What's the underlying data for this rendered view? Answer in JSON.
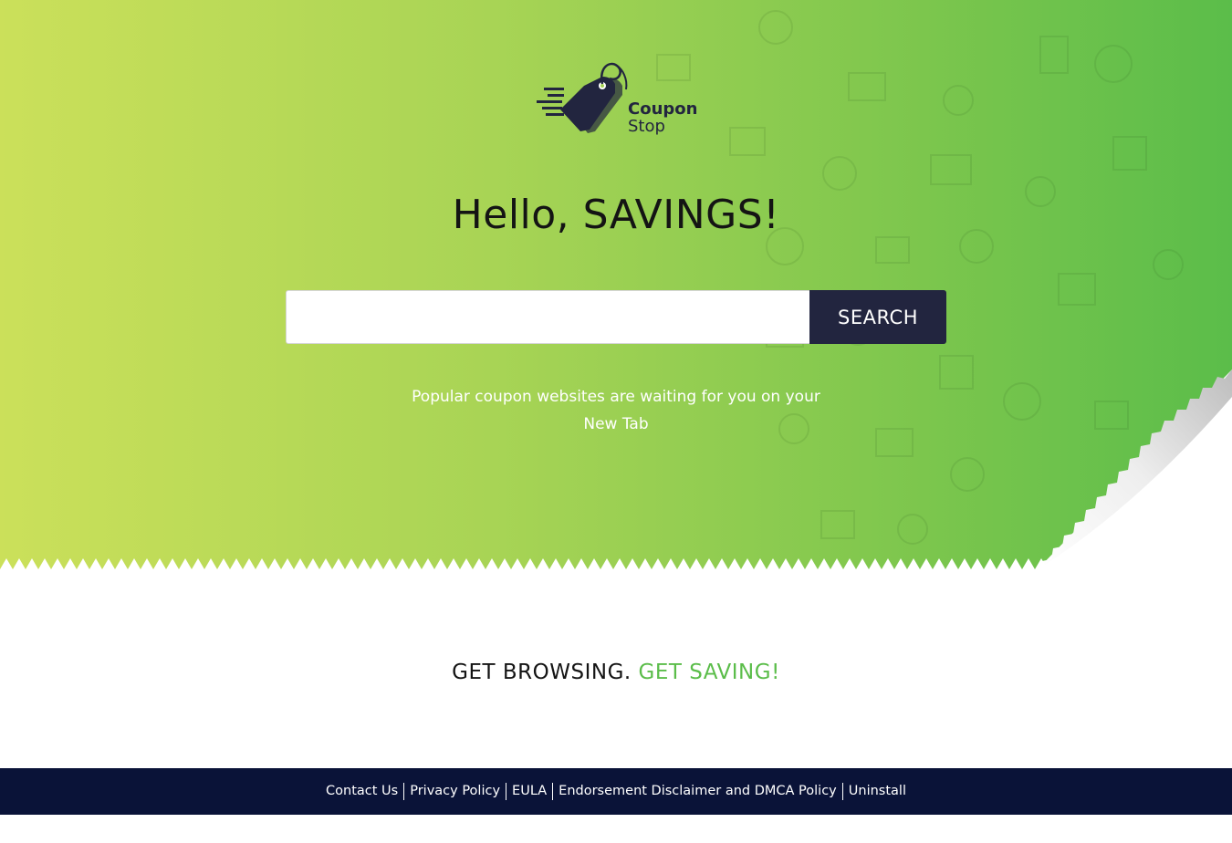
{
  "brand": {
    "name_line1": "Coupon",
    "name_line2": "Stop"
  },
  "hero": {
    "headline": "Hello, SAVINGS!",
    "search": {
      "value": "",
      "placeholder": "",
      "button_label": "SEARCH"
    },
    "tagline": "Popular coupon websites are waiting for you on your New Tab"
  },
  "cta": {
    "text": "GET BROWSING.",
    "accent": "GET SAVING!"
  },
  "footer": {
    "links": [
      {
        "label": "Contact Us"
      },
      {
        "label": "Privacy Policy"
      },
      {
        "label": "EULA"
      },
      {
        "label": "Endorsement Disclaimer and DMCA Policy"
      },
      {
        "label": "Uninstall"
      }
    ]
  },
  "colors": {
    "gradient_start": "#cbe05a",
    "gradient_end": "#5bbd4a",
    "navy": "#22253f",
    "footer_bg": "#0a1338",
    "accent_green": "#5bbd4a"
  },
  "icons": [
    "price-tag-icon",
    "speed-lines-icon",
    "page-peel-icon"
  ]
}
